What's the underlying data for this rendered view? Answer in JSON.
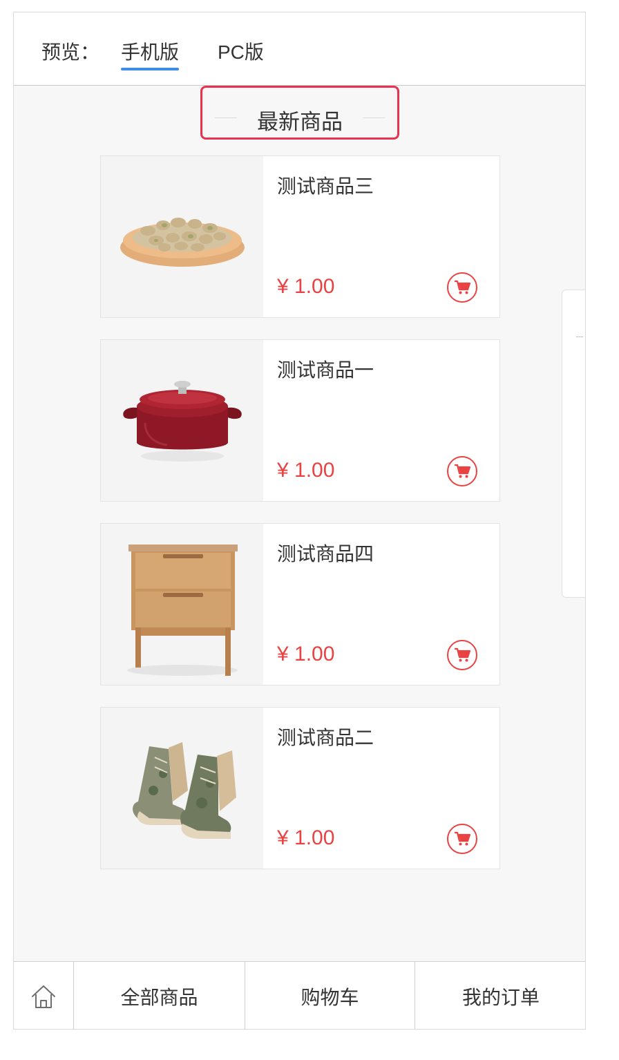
{
  "header": {
    "preview_label": "预览：",
    "tabs": [
      {
        "label": "手机版",
        "active": true
      },
      {
        "label": "PC版",
        "active": false
      }
    ]
  },
  "section": {
    "title": "最新商品"
  },
  "products": [
    {
      "name": "测试商品三",
      "price": "¥ 1.00",
      "image": "pistachio-bowl"
    },
    {
      "name": "测试商品一",
      "price": "¥ 1.00",
      "image": "red-cast-iron-pot"
    },
    {
      "name": "测试商品四",
      "price": "¥ 1.00",
      "image": "wooden-nightstand"
    },
    {
      "name": "测试商品二",
      "price": "¥ 1.00",
      "image": "camo-boots"
    }
  ],
  "bottom_nav": {
    "home_icon": "home-icon",
    "items": [
      {
        "label": "全部商品"
      },
      {
        "label": "购物车"
      },
      {
        "label": "我的订单"
      }
    ]
  },
  "colors": {
    "accent_blue": "#3f8ce5",
    "price_red": "#e84242",
    "highlight_border": "#e73350"
  }
}
